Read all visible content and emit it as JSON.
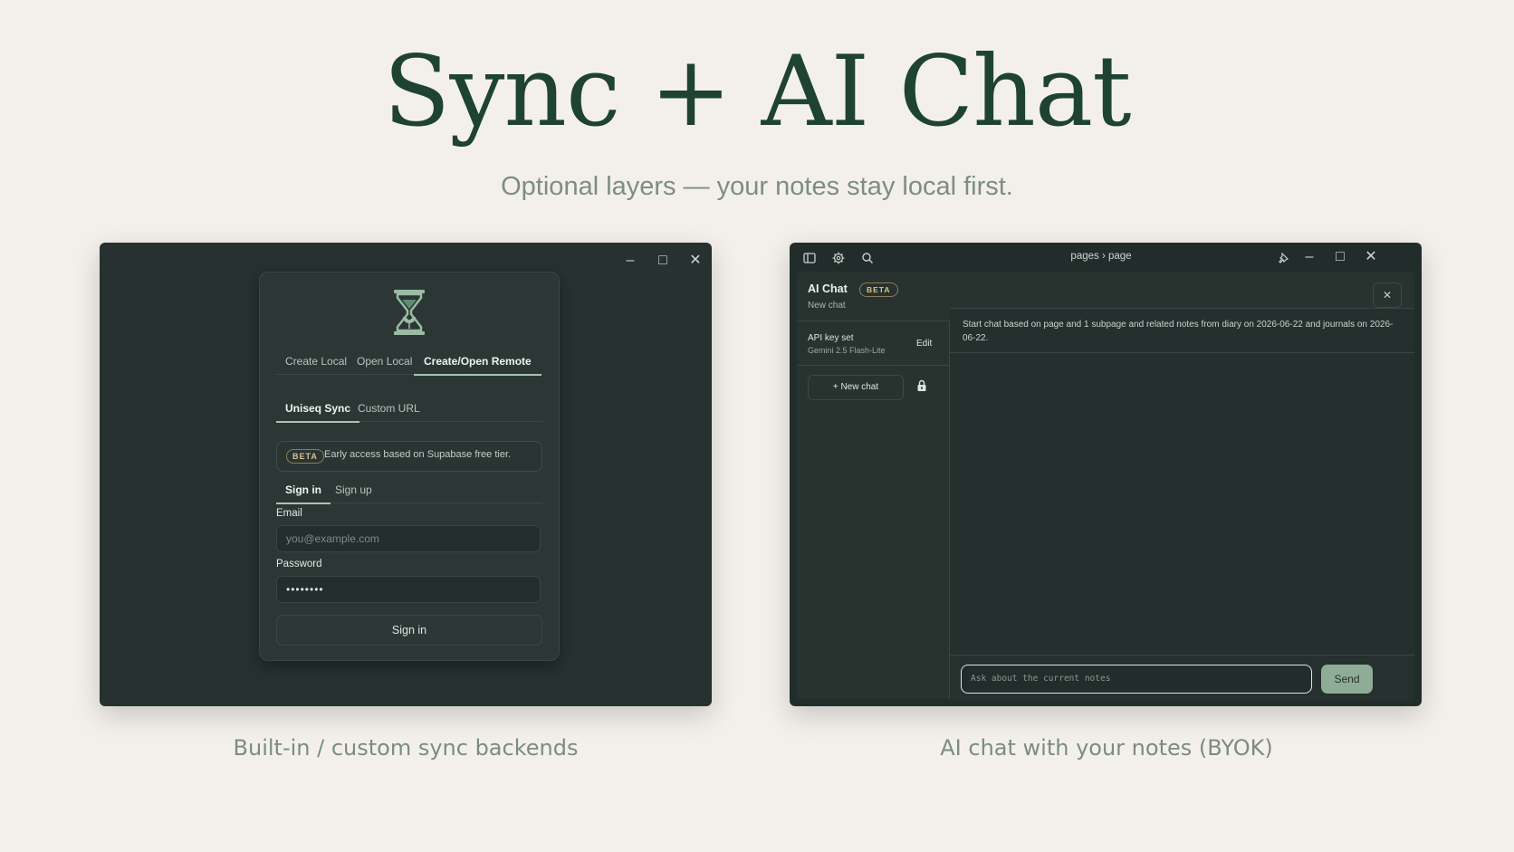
{
  "hero": {
    "title": "Sync + AI Chat",
    "subtitle": "Optional layers — your notes stay local first."
  },
  "captions": {
    "left": "Built-in / custom sync backends",
    "right": "AI chat with your notes (BYOK)"
  },
  "left_window": {
    "controls": {
      "minimize": "–",
      "maximize": "□",
      "close": "✕"
    },
    "mode_tabs": [
      {
        "label": "Create Local",
        "active": false
      },
      {
        "label": "Open Local",
        "active": false
      },
      {
        "label": "Create/Open Remote",
        "active": true
      }
    ],
    "backend_tabs": [
      {
        "label": "Uniseq Sync",
        "active": true
      },
      {
        "label": "Custom URL",
        "active": false
      }
    ],
    "beta_badge": "BETA",
    "beta_text": "Early access based on Supabase free tier.",
    "auth_tabs": [
      {
        "label": "Sign in",
        "active": true
      },
      {
        "label": "Sign up",
        "active": false
      }
    ],
    "email_label": "Email",
    "email_placeholder": "you@example.com",
    "password_label": "Password",
    "password_value": "••••••••",
    "signin_button": "Sign in",
    "icons": {
      "logo": "hourglass-sprout-icon"
    }
  },
  "right_window": {
    "breadcrumb": "pages › page",
    "icons": {
      "sidebar": "sidebar-toggle-icon",
      "settings": "gear-icon",
      "search": "search-icon",
      "pin": "pin-icon"
    },
    "controls": {
      "minimize": "–",
      "maximize": "□",
      "close": "✕"
    },
    "chat_title": "AI Chat",
    "chat_beta": "BETA",
    "chat_subtitle": "New chat",
    "close_label": "✕",
    "api_key_title": "API key set",
    "api_key_model": "Gemini 2.5 Flash-Lite",
    "edit_label": "Edit",
    "new_chat_label": "+ New chat",
    "info_text": "Start chat based on page and 1 subpage and related notes from diary on 2026-06-22 and journals on 2026-06-22.",
    "input_placeholder": "Ask about the current notes",
    "send_label": "Send"
  },
  "colors": {
    "background": "#f3f0eb",
    "title": "#1f4333",
    "window": "#263230",
    "accent": "#8fad96",
    "beta": "#d6c38e"
  }
}
